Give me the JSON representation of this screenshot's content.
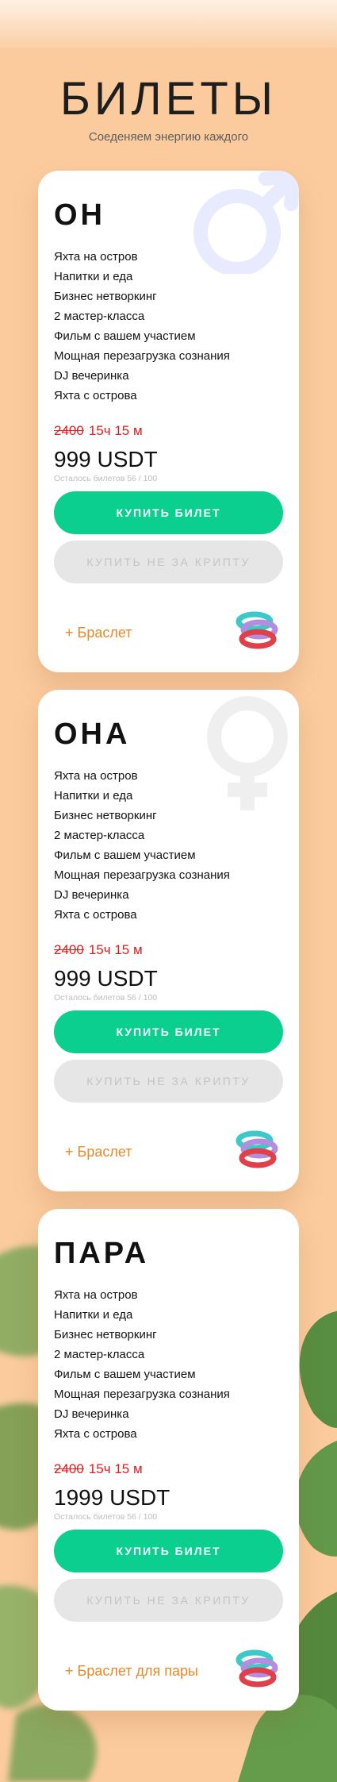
{
  "header": {
    "title": "БИЛЕТЫ",
    "subtitle": "Соеденяем энергию каждого"
  },
  "cards": [
    {
      "title": "ОН",
      "icon": "male-symbol-icon",
      "features": [
        "Яхта на остров",
        "Напитки и еда",
        "Бизнес нетворкинг",
        "2 мастер-класса",
        "Фильм с вашем участием",
        "Мощная перезагрузка сознания",
        "DJ вечеринка",
        "Яхта с острова"
      ],
      "old_price": "2400",
      "timer": "15ч 15 м",
      "price": "999 USDT",
      "remaining": "Осталось билетов 56 / 100",
      "buy_label": "КУПИТЬ БИЛЕТ",
      "alt_label": "КУПИТЬ НЕ ЗА КРИПТУ",
      "bracelet_label": "+ Браслет"
    },
    {
      "title": "ОНА",
      "icon": "female-symbol-icon",
      "features": [
        "Яхта на остров",
        "Напитки и еда",
        "Бизнес нетворкинг",
        "2 мастер-класса",
        "Фильм с вашем участием",
        "Мощная перезагрузка сознания",
        "DJ вечеринка",
        "Яхта с острова"
      ],
      "old_price": "2400",
      "timer": "15ч 15 м",
      "price": "999 USDT",
      "remaining": "Осталось билетов 56 / 100",
      "buy_label": "КУПИТЬ БИЛЕТ",
      "alt_label": "КУПИТЬ НЕ ЗА КРИПТУ",
      "bracelet_label": "+ Браслет"
    },
    {
      "title": "ПАРА",
      "features": [
        "Яхта на остров",
        "Напитки и еда",
        "Бизнес нетворкинг",
        "2 мастер-класса",
        "Фильм с вашем участием",
        "Мощная перезагрузка сознания",
        "DJ вечеринка",
        "Яхта с острова"
      ],
      "old_price": "2400",
      "timer": "15ч 15 м",
      "price": "1999 USDT",
      "remaining": "Осталось билетов 56 / 100",
      "buy_label": "КУПИТЬ БИЛЕТ",
      "alt_label": "КУПИТЬ НЕ ЗА КРИПТУ",
      "bracelet_label": "+ Браслет для пары"
    }
  ],
  "colors": {
    "background": "#FBCB9E",
    "buy_button": "#0ACF8E",
    "alt_button": "#E6E6E6",
    "old_price": "#E01B1B",
    "bracelet_link": "#E8892A"
  }
}
